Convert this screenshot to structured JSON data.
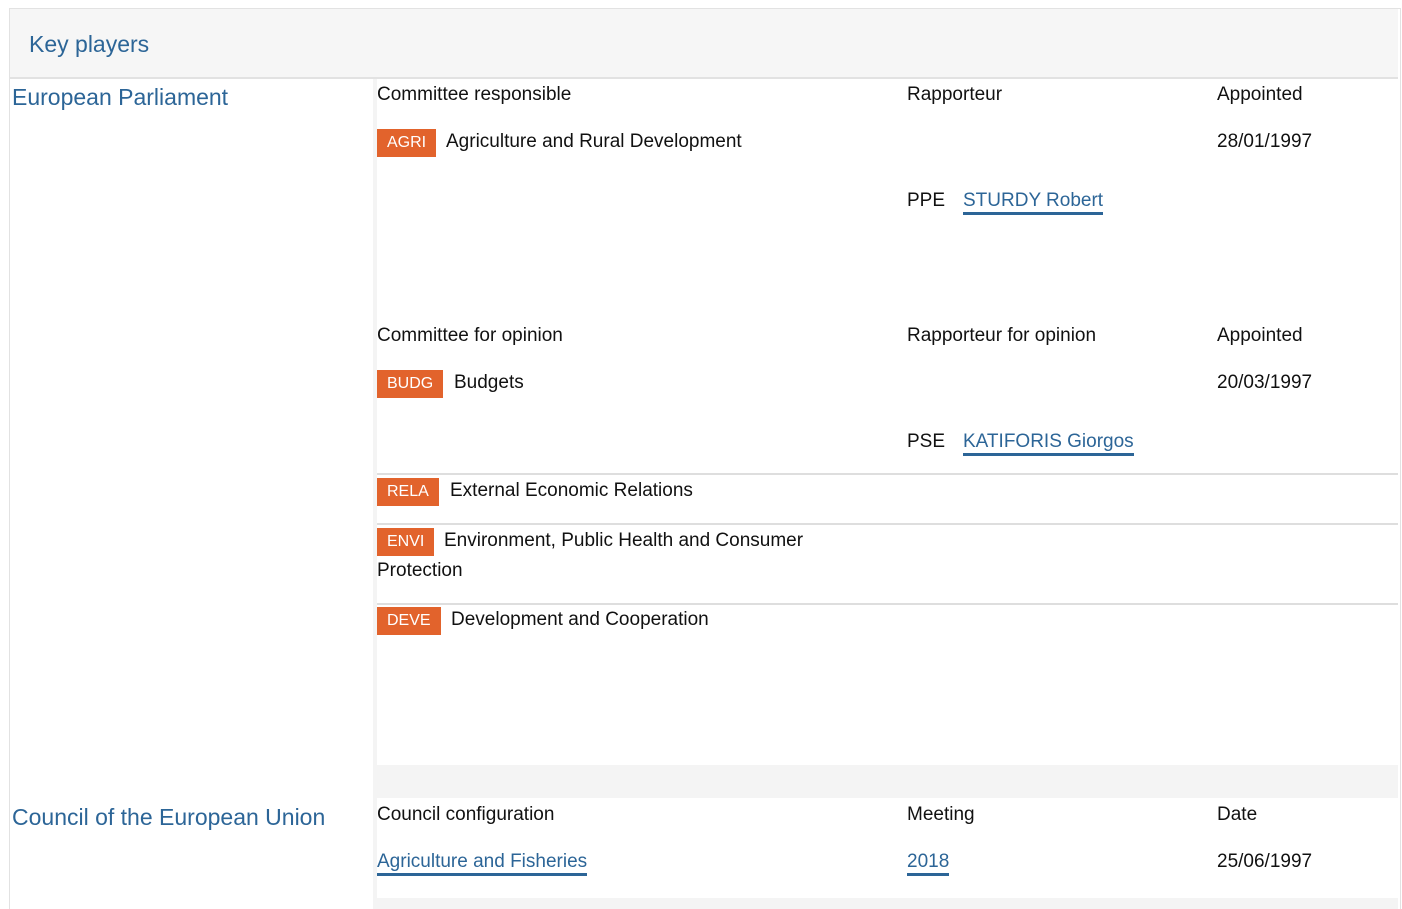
{
  "header": {
    "title": "Key players"
  },
  "ep": {
    "name": "European Parliament",
    "responsible": {
      "col_committee": "Committee responsible",
      "col_rapporteur": "Rapporteur",
      "col_appointed": "Appointed",
      "committee_code": "AGRI",
      "committee_name": "Agriculture and Rural Development",
      "appointed": "28/01/1997",
      "group": "PPE",
      "rapporteur": "STURDY Robert"
    },
    "opinion": {
      "col_committee": "Committee for opinion",
      "col_rapporteur": "Rapporteur for opinion",
      "col_appointed": "Appointed",
      "committee_code": "BUDG",
      "committee_name": "Budgets",
      "appointed": "20/03/1997",
      "group": "PSE",
      "rapporteur": "KATIFORIS Giorgos"
    },
    "other_committees": [
      {
        "code": "RELA",
        "name": "External Economic Relations"
      },
      {
        "code": "ENVI",
        "name_line1": "Environment, Public Health and Consumer",
        "name_line2": "Protection"
      },
      {
        "code": "DEVE",
        "name": "Development and Cooperation"
      }
    ]
  },
  "council": {
    "name": "Council of the European Union",
    "col_configuration": "Council configuration",
    "col_meeting": "Meeting",
    "col_date": "Date",
    "configuration": "Agriculture and Fisheries",
    "meeting": "2018",
    "date": "25/06/1997"
  },
  "colors": {
    "link": "#2c6597",
    "badge": "#e2632c",
    "panel_bg": "#f4f4f4"
  }
}
